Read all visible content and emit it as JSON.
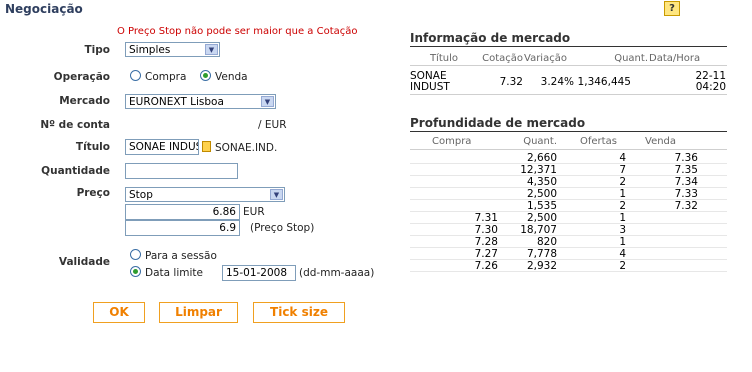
{
  "title": "Negociação",
  "help_label": "?",
  "error_message": "O Preço Stop não pode ser maior que a Cotação",
  "form": {
    "tipo_label": "Tipo",
    "tipo_value": "Simples",
    "operacao_label": "Operação",
    "operacao_options": [
      "Compra",
      "Venda"
    ],
    "operacao_selected": "Venda",
    "mercado_label": "Mercado",
    "mercado_value": "EURONEXT Lisboa",
    "conta_label": "Nº de conta",
    "conta_currency": "/ EUR",
    "titulo_label": "Título",
    "titulo_value": "SONAE INDUST",
    "titulo_code": "SONAE.IND.",
    "quantidade_label": "Quantidade",
    "quantidade_value": "",
    "preco_label": "Preço",
    "preco_type": "Stop",
    "preco_value": "6.86",
    "preco_currency": "EUR",
    "preco_stop_value": "6.9",
    "preco_stop_note": "(Preço Stop)",
    "validade_label": "Validade",
    "validade_options": [
      "Para a sessão",
      "Data limite"
    ],
    "validade_selected": "Data limite",
    "data_limite": "15-01-2008",
    "data_format": "(dd-mm-aaaa)"
  },
  "buttons": {
    "ok": "OK",
    "limpar": "Limpar",
    "tick": "Tick size"
  },
  "info": {
    "title": "Informação de mercado",
    "headers": [
      "Título",
      "Cotação",
      "Variação",
      "Quant.",
      "Data/Hora"
    ],
    "row": {
      "titulo_1": "SONAE",
      "titulo_2": "INDUST",
      "cotacao": "7.32",
      "variacao": "3.24%",
      "quant": "1,346,445",
      "data": "22-11",
      "hora": "04:20"
    }
  },
  "depth": {
    "title": "Profundidade de mercado",
    "headers": [
      "Compra",
      "Quant.",
      "Ofertas",
      "Venda"
    ],
    "rows": [
      [
        "",
        "2,660",
        "4",
        "7.36"
      ],
      [
        "",
        "12,371",
        "7",
        "7.35"
      ],
      [
        "",
        "4,350",
        "2",
        "7.34"
      ],
      [
        "",
        "2,500",
        "1",
        "7.33"
      ],
      [
        "",
        "1,535",
        "2",
        "7.32"
      ],
      [
        "7.31",
        "2,500",
        "1",
        ""
      ],
      [
        "7.30",
        "18,707",
        "3",
        ""
      ],
      [
        "7.28",
        "820",
        "1",
        ""
      ],
      [
        "7.27",
        "7,778",
        "4",
        ""
      ],
      [
        "7.26",
        "2,932",
        "2",
        ""
      ]
    ]
  }
}
